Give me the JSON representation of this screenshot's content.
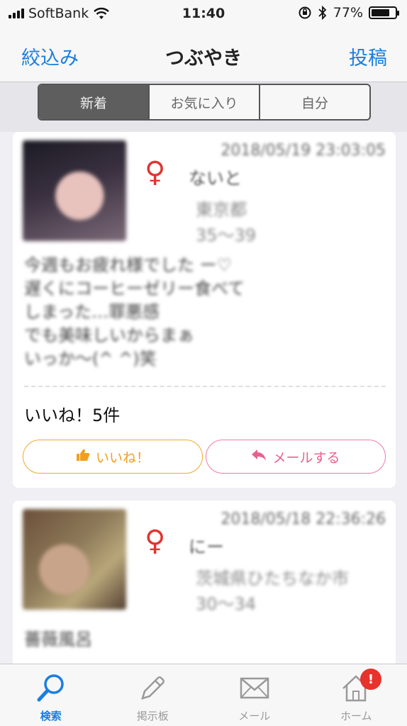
{
  "status_bar": {
    "carrier": "SoftBank",
    "time": "11:40",
    "battery_percent": "77%",
    "battery_level": 0.77
  },
  "nav": {
    "left_label": "絞込み",
    "title": "つぶやき",
    "right_label": "投稿"
  },
  "segments": [
    "新着",
    "お気に入り",
    "自分"
  ],
  "posts": [
    {
      "datetime": "2018/05/19 23:03:05",
      "gender_symbol": "♀",
      "name": "ないと",
      "location": "東京都",
      "age": "35～39",
      "body": "今週もお疲れ様でした ー♡\n遅くにコーヒーゼリー食べて\nしまった…罪悪感\nでも美味しいからまぁ\nいっか〜(^ ^)笑",
      "likes_text": "いいね！5件",
      "like_button": "いいね！",
      "mail_button": "メールする"
    },
    {
      "datetime": "2018/05/18 22:36:26",
      "gender_symbol": "♀",
      "name": "にー",
      "location": "茨城県ひたちなか市",
      "age": "30～34",
      "body": "薔薇風呂"
    }
  ],
  "tabs": [
    {
      "label": "検索",
      "icon": "search-icon"
    },
    {
      "label": "掲示板",
      "icon": "pencil-icon"
    },
    {
      "label": "メール",
      "icon": "mail-icon"
    },
    {
      "label": "ホーム",
      "icon": "home-icon"
    }
  ],
  "home_badge": "!",
  "colors": {
    "accent": "#1a7ee0",
    "female": "#e0352f",
    "like": "#f0a020",
    "mail": "#e8608f"
  }
}
